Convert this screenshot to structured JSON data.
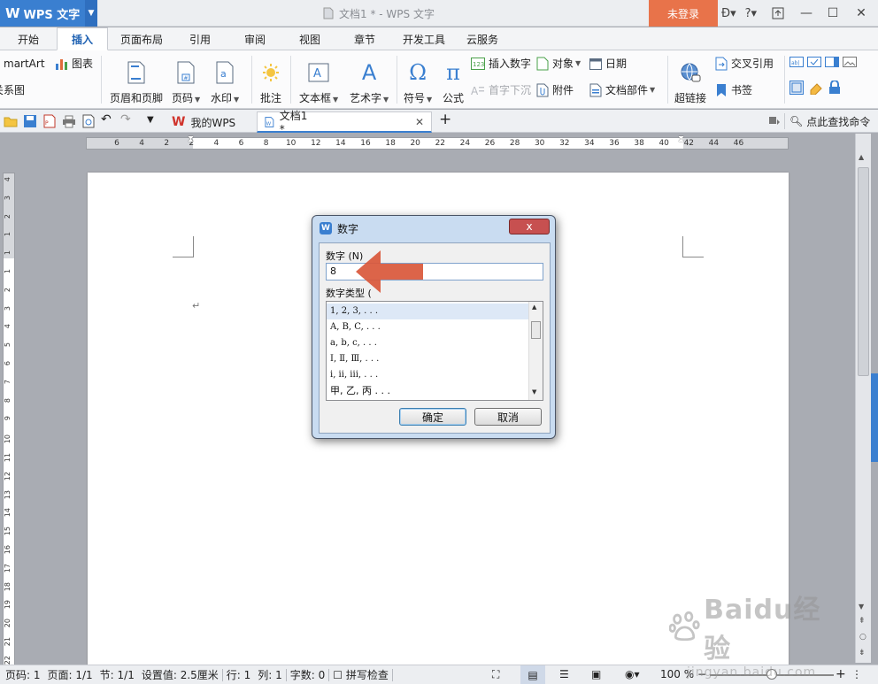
{
  "titlebar": {
    "app_name": "WPS 文字",
    "app_logo": "W",
    "document_title": "文档1 * - WPS 文字",
    "login_label": "未登录",
    "help_label": "?"
  },
  "ribbon_tabs": [
    "开始",
    "插入",
    "页面布局",
    "引用",
    "审阅",
    "视图",
    "章节",
    "开发工具",
    "云服务"
  ],
  "ribbon_active_tab": "插入",
  "ribbon": {
    "smartart_partial": "martArt",
    "chart": "图表",
    "relation_partial": "关系图",
    "header_footer": "页眉和页脚",
    "page_number": "页码",
    "watermark": "水印",
    "comment": "批注",
    "textbox": "文本框",
    "wordart": "艺术字",
    "symbol": "符号",
    "formula": "公式",
    "insert_number": "插入数字",
    "drop_cap": "首字下沉",
    "object": "对象",
    "attachment": "附件",
    "date": "日期",
    "doc_parts": "文档部件",
    "hyperlink": "超链接",
    "cross_ref": "交叉引用",
    "bookmark": "书签"
  },
  "quickbar": {
    "doc_tabs": [
      {
        "label": "我的WPS",
        "active": false
      },
      {
        "label": "文档1 *",
        "active": true
      }
    ],
    "search_label": "点此查找命令"
  },
  "ruler": {
    "h_numbers": [
      "6",
      "4",
      "2",
      "2",
      "4",
      "6",
      "8",
      "10",
      "12",
      "14",
      "16",
      "18",
      "20",
      "22",
      "24",
      "26",
      "28",
      "30",
      "32",
      "34",
      "36",
      "38",
      "40",
      "42",
      "44",
      "46"
    ],
    "v_numbers": [
      "4",
      "3",
      "2",
      "1",
      "1",
      "1",
      "2",
      "3",
      "4",
      "5",
      "6",
      "7",
      "8",
      "9",
      "10",
      "11",
      "12",
      "13",
      "14",
      "15",
      "16",
      "17",
      "18",
      "19",
      "20",
      "21",
      "22"
    ]
  },
  "dialog": {
    "title": "数字",
    "number_label": "数字 (N)",
    "number_value": "8",
    "type_label": "数字类型 (",
    "types": [
      "1, 2, 3, . . .",
      "A, B, C, . . .",
      "a, b, c, . . .",
      "Ⅰ, Ⅱ, Ⅲ, . . .",
      "i, ii, iii, . . .",
      "甲, 乙, 丙 . . ."
    ],
    "selected_type_index": 0,
    "ok_label": "确定",
    "cancel_label": "取消",
    "close_label": "x"
  },
  "statusbar": {
    "page_num": "页码: 1",
    "pages": "页面: 1/1",
    "section": "节: 1/1",
    "setting": "设置值: 2.5厘米",
    "line": "行: 1",
    "column": "列: 1",
    "word_count": "字数: 0",
    "spell_check": "拼写检查",
    "zoom": "100 %"
  },
  "watermark_text": {
    "brand": "Baidu经验",
    "url": "jingyan.baidu.com"
  },
  "colors": {
    "accent_blue": "#3a7fd0",
    "login_orange": "#e8734a",
    "arrow_red": "#d9573a",
    "dialog_frame": "#c9dcf1"
  }
}
